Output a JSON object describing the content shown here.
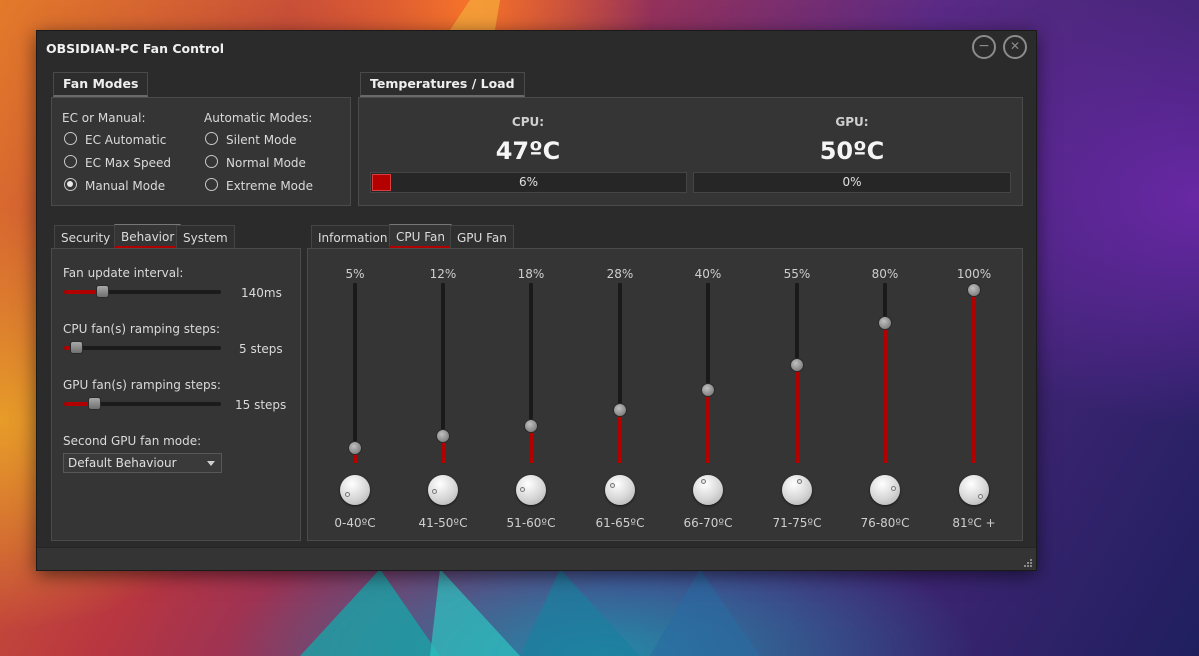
{
  "window": {
    "title": "OBSIDIAN-PC Fan Control",
    "minimize_glyph": "−",
    "close_glyph": "✕"
  },
  "fan_modes": {
    "group_label": "Fan Modes",
    "ec_or_manual_label": "EC or Manual:",
    "automatic_modes_label": "Automatic Modes:",
    "ec_options": [
      {
        "label": "EC Automatic",
        "selected": false
      },
      {
        "label": "EC Max Speed",
        "selected": false
      },
      {
        "label": "Manual Mode",
        "selected": true
      }
    ],
    "auto_options": [
      {
        "label": "Silent Mode",
        "selected": false
      },
      {
        "label": "Normal Mode",
        "selected": false
      },
      {
        "label": "Extreme Mode",
        "selected": false
      }
    ]
  },
  "temps": {
    "group_label": "Temperatures / Load",
    "cpu": {
      "label": "CPU:",
      "value": "47ºC",
      "load_text": "6%",
      "load": 0.06
    },
    "gpu": {
      "label": "GPU:",
      "value": "50ºC",
      "load_text": "0%",
      "load": 0.0
    }
  },
  "left_tabs": [
    "Security",
    "Behavior",
    "System"
  ],
  "left_active_tab": 1,
  "behavior": {
    "update_interval": {
      "label": "Fan update interval:",
      "value_text": "140ms",
      "level": 0.22
    },
    "cpu_steps": {
      "label": "CPU fan(s) ramping steps:",
      "value_text": "5 steps",
      "level": 0.04
    },
    "gpu_steps": {
      "label": "GPU fan(s) ramping steps:",
      "value_text": "15 steps",
      "level": 0.17
    },
    "second_gpu": {
      "label": "Second GPU fan mode:",
      "selected": "Default Behaviour"
    }
  },
  "right_tabs": [
    "Information",
    "CPU Fan",
    "GPU Fan"
  ],
  "right_active_tab": 1,
  "cpu_fan_curve": [
    {
      "percent_text": "5%",
      "level": 0.05,
      "range": "0-40ºC"
    },
    {
      "percent_text": "12%",
      "level": 0.12,
      "range": "41-50ºC"
    },
    {
      "percent_text": "18%",
      "level": 0.18,
      "range": "51-60ºC"
    },
    {
      "percent_text": "28%",
      "level": 0.28,
      "range": "61-65ºC"
    },
    {
      "percent_text": "40%",
      "level": 0.4,
      "range": "66-70ºC"
    },
    {
      "percent_text": "55%",
      "level": 0.55,
      "range": "71-75ºC"
    },
    {
      "percent_text": "80%",
      "level": 0.8,
      "range": "76-80ºC"
    },
    {
      "percent_text": "100%",
      "level": 1.0,
      "range": "81ºC +"
    }
  ],
  "colors": {
    "accent": "#b00000",
    "window_bg": "#2b2b2b",
    "panel_bg": "#353535"
  },
  "icons": {
    "minimize": "minimize-icon",
    "close": "close-icon",
    "dropdown": "chevron-down-icon",
    "resize": "resize-grip-icon"
  }
}
